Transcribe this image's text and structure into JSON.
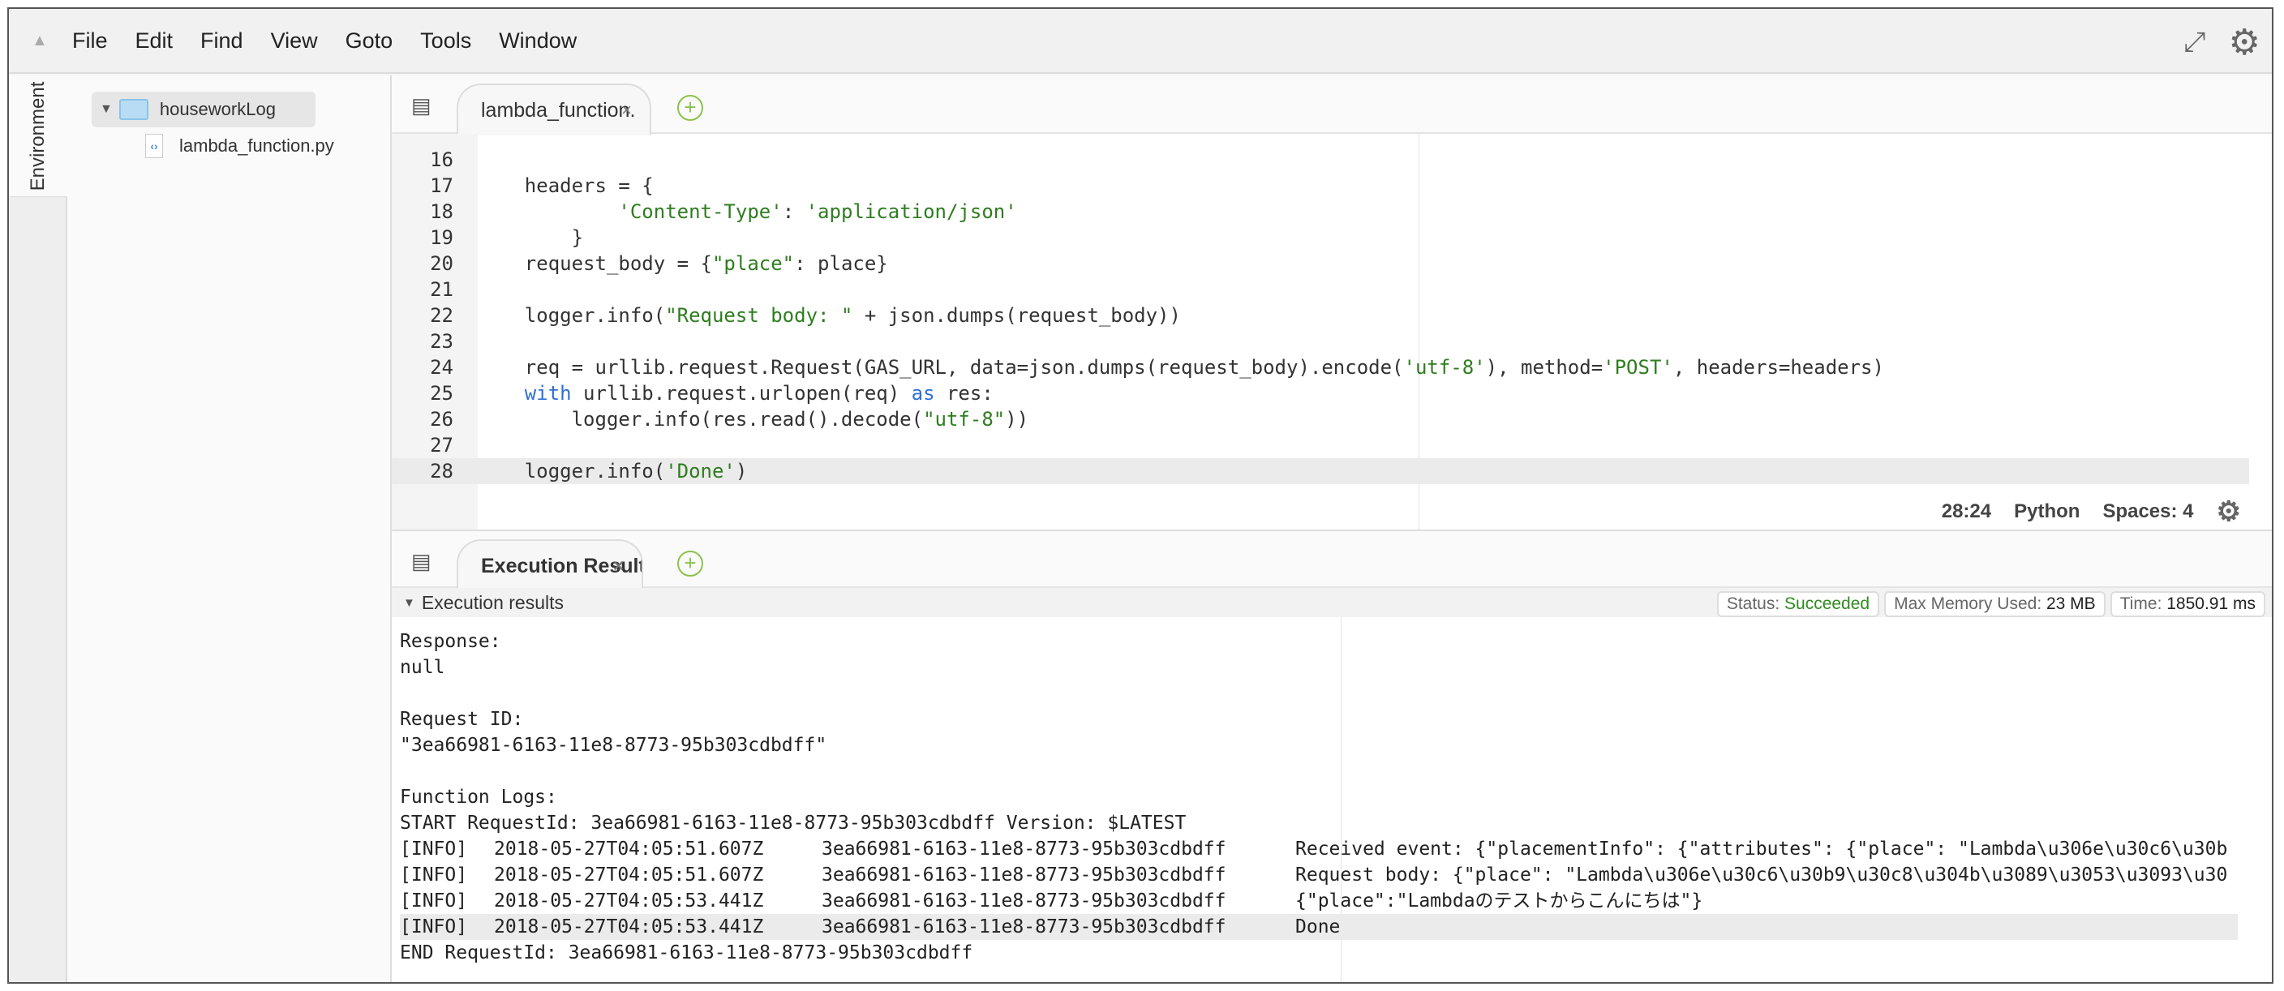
{
  "menu": [
    "File",
    "Edit",
    "Find",
    "View",
    "Goto",
    "Tools",
    "Window"
  ],
  "sidebar": {
    "tab": "Environment",
    "root": "houseworkLog",
    "file": "lambda_function.py"
  },
  "editor": {
    "tab": "lambda_function.",
    "lines": [
      {
        "n": "16",
        "html": ""
      },
      {
        "n": "17",
        "html": "    headers = {"
      },
      {
        "n": "18",
        "html": "            <span class='s'>'Content-Type'</span>: <span class='s'>'application/json'</span>"
      },
      {
        "n": "19",
        "html": "        }"
      },
      {
        "n": "20",
        "html": "    request_body = {<span class='s'>\"place\"</span>: place}"
      },
      {
        "n": "21",
        "html": ""
      },
      {
        "n": "22",
        "html": "    logger.info(<span class='s'>\"Request body: \"</span> + json.dumps(request_body))"
      },
      {
        "n": "23",
        "html": ""
      },
      {
        "n": "24",
        "html": "    req = urllib.request.Request(GAS_URL, data=json.dumps(request_body).encode(<span class='s'>'utf-8'</span>), method=<span class='s'>'POST'</span>, headers=headers)"
      },
      {
        "n": "25",
        "html": "    <span class='k'>with</span> urllib.request.urlopen(req) <span class='k'>as</span> res:"
      },
      {
        "n": "26",
        "html": "        logger.info(res.read().decode(<span class='s'>\"utf-8\"</span>))"
      },
      {
        "n": "27",
        "html": ""
      },
      {
        "n": "28",
        "html": "    logger.info(<span class='s'>'Done'</span>)"
      }
    ],
    "status": {
      "cursor": "28:24",
      "language": "Python",
      "spaces": "Spaces: 4"
    }
  },
  "results": {
    "tab": "Execution Result",
    "header": "Execution results",
    "status_label": "Status: ",
    "status": "Succeeded",
    "memory_label": "Max Memory Used: ",
    "memory": "23 MB",
    "time_label": "Time: ",
    "time": "1850.91 ms",
    "lines": [
      "Response:",
      "null",
      "",
      "Request ID:",
      "\"3ea66981-6163-11e8-8773-95b303cdbdff\"",
      "",
      "Function Logs:",
      "START RequestId: 3ea66981-6163-11e8-8773-95b303cdbdff Version: $LATEST"
    ],
    "logs": [
      [
        "[INFO]",
        "2018-05-27T04:05:51.607Z",
        "3ea66981-6163-11e8-8773-95b303cdbdff",
        "Received event: {\"placementInfo\": {\"attributes\": {\"place\": \"Lambda\\u306e\\u30c6\\u30b"
      ],
      [
        "[INFO]",
        "2018-05-27T04:05:51.607Z",
        "3ea66981-6163-11e8-8773-95b303cdbdff",
        "Request body: {\"place\": \"Lambda\\u306e\\u30c6\\u30b9\\u30c8\\u304b\\u3089\\u3053\\u3093\\u30"
      ],
      [
        "[INFO]",
        "2018-05-27T04:05:53.441Z",
        "3ea66981-6163-11e8-8773-95b303cdbdff",
        "{\"place\":\"Lambdaのテストからこんにちは\"}"
      ],
      [
        "[INFO]",
        "2018-05-27T04:05:53.441Z",
        "3ea66981-6163-11e8-8773-95b303cdbdff",
        "Done"
      ]
    ],
    "end": "END RequestId: 3ea66981-6163-11e8-8773-95b303cdbdff"
  }
}
